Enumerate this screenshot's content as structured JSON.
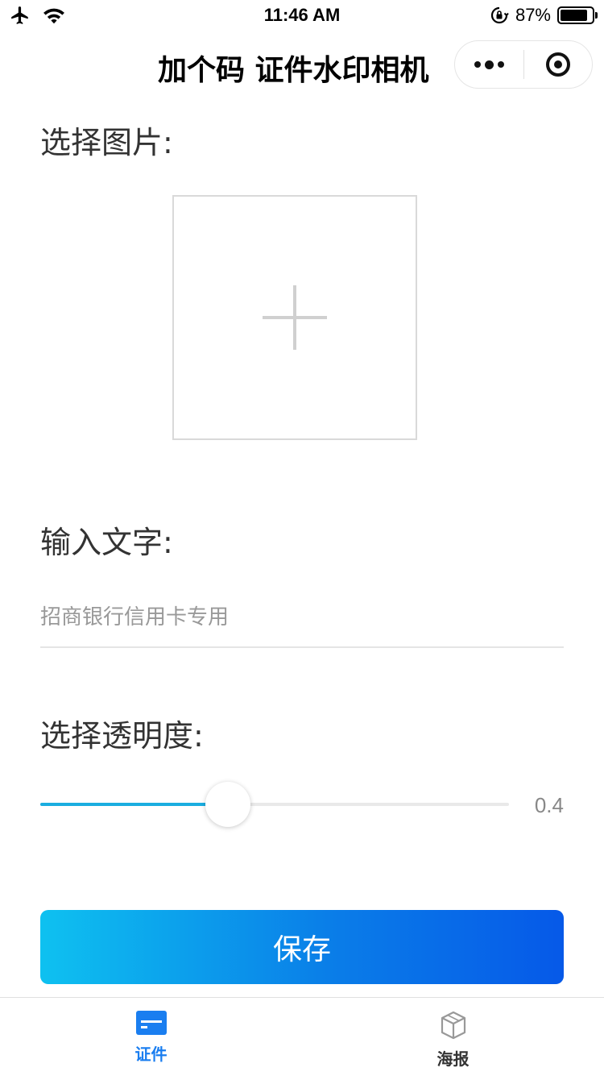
{
  "status_bar": {
    "time": "11:46 AM",
    "battery_percent": "87%",
    "battery_level": 0.87
  },
  "nav": {
    "title": "加个码 证件水印相机"
  },
  "sections": {
    "select_image_label": "选择图片:",
    "input_text_label": "输入文字:",
    "opacity_label": "选择透明度:"
  },
  "text_input": {
    "placeholder": "招商银行信用卡专用",
    "value": ""
  },
  "opacity_slider": {
    "value": 0.4,
    "value_label": "0.4",
    "min": 0,
    "max": 1
  },
  "save_button": {
    "label": "保存"
  },
  "tab_bar": {
    "tabs": [
      {
        "label": "证件",
        "active": true
      },
      {
        "label": "海报",
        "active": false
      }
    ]
  },
  "colors": {
    "accent": "#1a7ef0",
    "slider_fill": "#1aade0",
    "button_gradient_start": "#0ec1f0",
    "button_gradient_end": "#0659e8"
  }
}
